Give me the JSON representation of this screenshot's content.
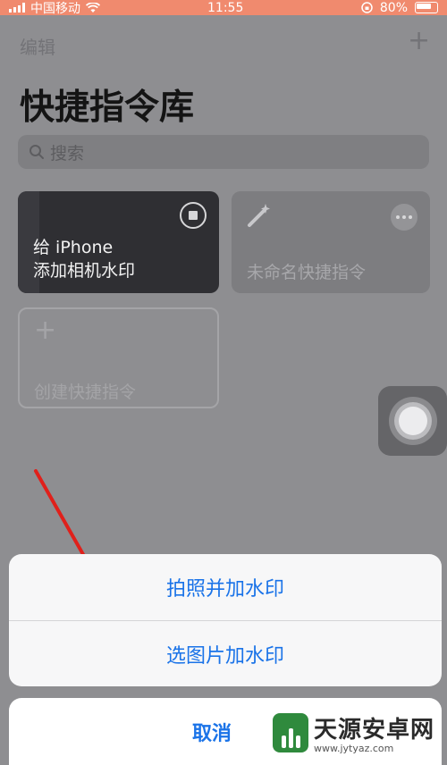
{
  "status_bar": {
    "carrier": "中国移动",
    "time": "11:55",
    "battery": "80%"
  },
  "header": {
    "edit_label": "编辑",
    "title": "快捷指令库"
  },
  "search": {
    "placeholder": "搜索"
  },
  "shortcuts": [
    {
      "line1": "给 iPhone",
      "line2": "添加相机水印"
    },
    {
      "line1": "未命名快捷指令"
    }
  ],
  "create_label": "创建快捷指令",
  "action_sheet": {
    "options": [
      "拍照并加水印",
      "选图片加水印"
    ],
    "cancel": "取消"
  },
  "watermark": {
    "name": "天源安卓网",
    "url": "www.jytyaz.com"
  },
  "colors": {
    "accent_blue": "#1a73e8",
    "annotation_arrow": "#e0201b",
    "status_bar": "#f08a6e"
  }
}
